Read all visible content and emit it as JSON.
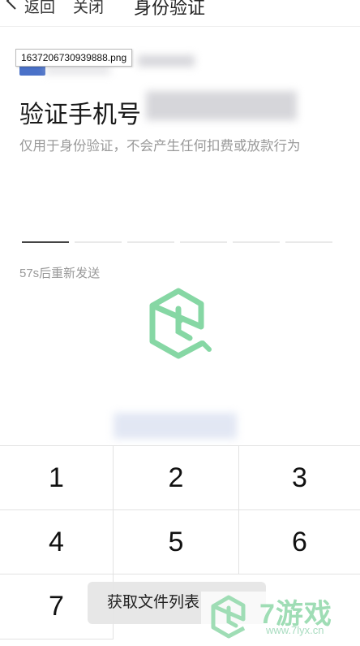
{
  "header": {
    "back_label": "返回",
    "close_label": "关闭",
    "title": "身份验证"
  },
  "file_tip": "1637206730939888.png",
  "verify": {
    "title": "验证手机号",
    "subtitle": "仅用于身份验证，不会产生任何扣费或放款行为",
    "resend": "57s后重新发送"
  },
  "keypad": {
    "keys": [
      "1",
      "2",
      "3",
      "4",
      "5",
      "6",
      "7"
    ]
  },
  "toast": "获取文件列表",
  "watermark": {
    "brand": "7游戏",
    "url": "www.7lyx.cn"
  },
  "colors": {
    "accent": "#4a71c8",
    "watermark_green": "#9fddb5"
  }
}
